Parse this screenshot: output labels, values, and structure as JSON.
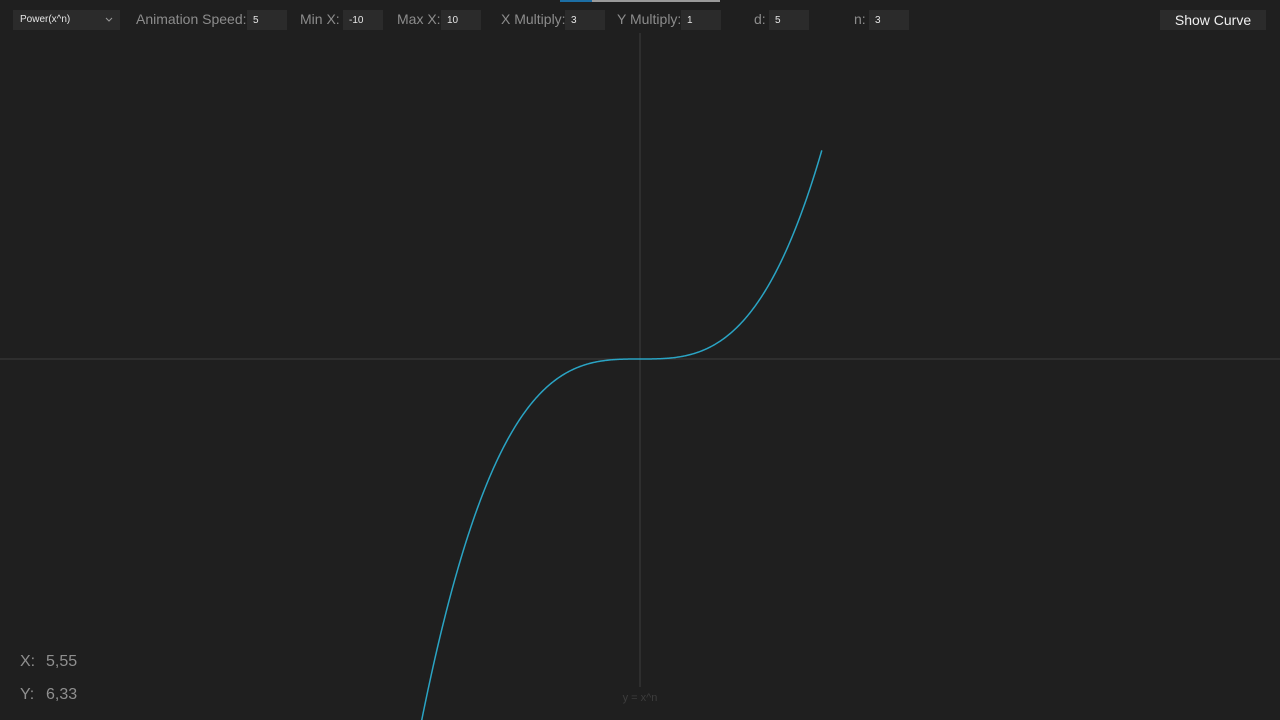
{
  "toolbar": {
    "function_select": {
      "value": "Power(x^n)"
    },
    "animation_speed": {
      "label": "Animation Speed:",
      "value": "5"
    },
    "min_x": {
      "label": "Min X:",
      "value": "-10"
    },
    "max_x": {
      "label": "Max X:",
      "value": "10"
    },
    "x_multiply": {
      "label": "X Multiply:",
      "value": "3"
    },
    "y_multiply": {
      "label": "Y Multiply:",
      "value": "1"
    },
    "d": {
      "label": "d:",
      "value": "5"
    },
    "n": {
      "label": "n:",
      "value": "3"
    },
    "show_curve_label": "Show Curve"
  },
  "progress": {
    "fraction": 0.2
  },
  "equation_label": "y = x^n",
  "readout": {
    "x_label": "X:",
    "x_value": "5,55",
    "y_label": "Y:",
    "y_value": "6,33"
  },
  "colors": {
    "background": "#1f1f1f",
    "curve": "#2aa4c4",
    "axis": "#3c3c3c",
    "progress_fill": "#1c6ea4"
  }
}
